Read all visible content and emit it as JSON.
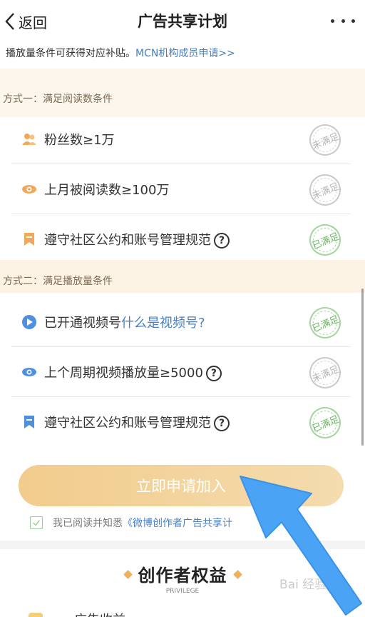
{
  "nav": {
    "back_label": "返回",
    "title": "广告共享计划"
  },
  "intro": {
    "text": "播放量条件可获得对应补贴。",
    "link": "MCN机构成员申请>>"
  },
  "section1": {
    "title": "方式一：满足阅读数条件",
    "items": [
      {
        "label": "粉丝数≥1万",
        "icon": "fans-icon",
        "status": "未满足",
        "met": false
      },
      {
        "label": "上月被阅读数≥100万",
        "icon": "eye-icon",
        "status": "未满足",
        "met": false
      },
      {
        "label": "遵守社区公约和账号管理规范",
        "icon": "bookmark-icon",
        "status": "已满足",
        "met": true,
        "help": "?"
      }
    ]
  },
  "section2": {
    "title": "方式二：满足播放量条件",
    "items": [
      {
        "label": "已开通视频号",
        "link": "什么是视频号?",
        "icon": "video-channel-icon",
        "status": "已满足",
        "met": true
      },
      {
        "label": "上个周期视频播放量≥5000",
        "icon": "eye-icon",
        "status": "未满足",
        "met": false,
        "help": "?"
      },
      {
        "label": "遵守社区公约和账号管理规范",
        "icon": "bookmark-icon",
        "status": "已满足",
        "met": true,
        "help": "?"
      }
    ]
  },
  "apply_button": "立即申请加入",
  "agreement": {
    "prefix": "我已阅读并知悉",
    "link": "《微博创作者广告共享计"
  },
  "privilege": {
    "title": "创作者权益",
    "subtitle": "PRIVILEGE"
  },
  "bottom": {
    "text": "广告收益"
  },
  "watermark": "Bai 经验",
  "colors": {
    "accent": "#f2cc8d",
    "link": "#4a7fc0",
    "met": "#6fb865",
    "unmet": "#b8b8b8",
    "arrow": "#4aa3f5"
  }
}
